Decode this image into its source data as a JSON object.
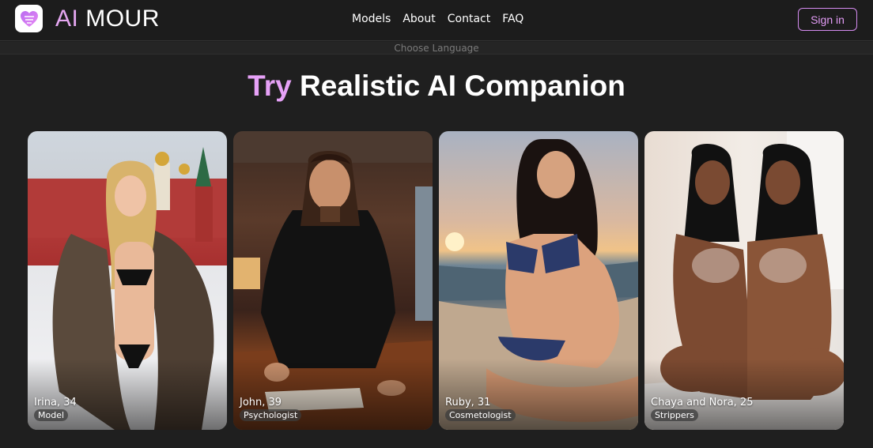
{
  "brand": {
    "name_part1": "AI",
    "name_part2": "MOUR",
    "logo_icon": "heart-icon",
    "accent_color": "#e6a1f7"
  },
  "nav": {
    "items": [
      {
        "label": "Models"
      },
      {
        "label": "About"
      },
      {
        "label": "Contact"
      },
      {
        "label": "FAQ"
      }
    ],
    "signin_label": "Sign in"
  },
  "language": {
    "label": "Choose Language"
  },
  "hero": {
    "accent_word": "Try",
    "rest": "Realistic AI Companion"
  },
  "cards": [
    {
      "name": "Irina, 34",
      "tag": "Model"
    },
    {
      "name": "John, 39",
      "tag": "Psychologist"
    },
    {
      "name": "Ruby, 31",
      "tag": "Cosmetologist"
    },
    {
      "name": "Chaya and Nora, 25",
      "tag": "Strippers"
    }
  ]
}
